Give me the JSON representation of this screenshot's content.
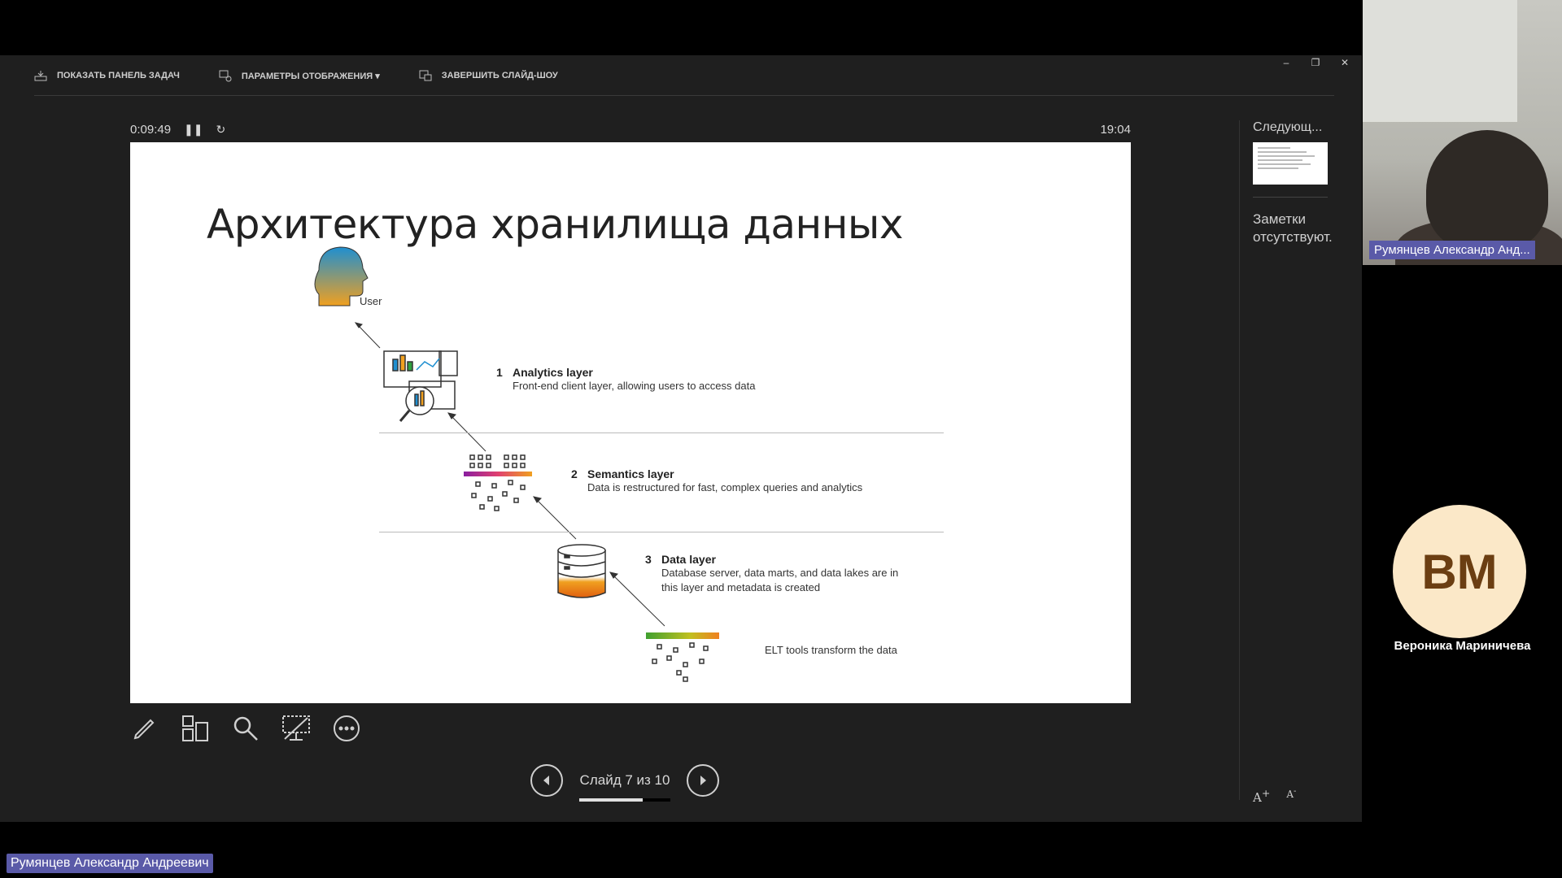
{
  "toolbar": {
    "show_taskbar": "ПОКАЗАТЬ ПАНЕЛЬ ЗАДАЧ",
    "display_settings": "ПАРАМЕТРЫ ОТОБРАЖЕНИЯ ▾",
    "end_show": "ЗАВЕРШИТЬ СЛАЙД-ШОУ"
  },
  "timer": {
    "elapsed": "0:09:49",
    "clock": "19:04"
  },
  "slide": {
    "title": "Архитектура хранилища данных",
    "user_label": "User",
    "layers": [
      {
        "num": "1",
        "name": "Analytics layer",
        "desc": "Front-end client layer, allowing users to access data"
      },
      {
        "num": "2",
        "name": "Semantics layer",
        "desc": "Data is restructured for fast, complex queries and analytics"
      },
      {
        "num": "3",
        "name": "Data layer",
        "desc": "Database server, data marts, and data lakes are in this layer and metadata is created"
      }
    ],
    "elt_label": "ELT tools transform the data"
  },
  "navigation": {
    "counter": "Слайд 7 из 10",
    "progress": 0.7
  },
  "sidebar": {
    "next_label": "Следующ...",
    "notes": "Заметки отсутствуют."
  },
  "participants": {
    "video_name": "Румянцев Александр Анд...",
    "avatar_initials": "ВМ",
    "avatar_name": "Вероника Мариничева",
    "bottom_name": "Румянцев Александр Андреевич"
  },
  "icons": [
    "taskbar-icon",
    "display-settings-icon",
    "end-show-icon",
    "pause-icon",
    "restart-icon",
    "pen-icon",
    "slides-grid-icon",
    "zoom-icon",
    "screen-icon",
    "more-icon",
    "prev-icon",
    "next-icon"
  ]
}
